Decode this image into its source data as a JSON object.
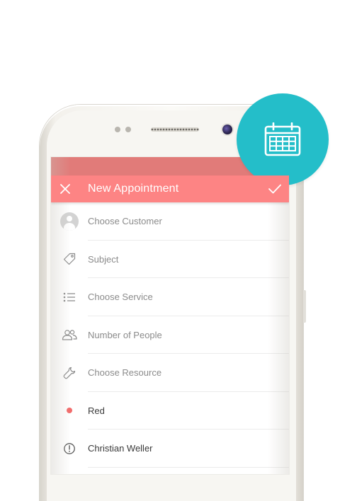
{
  "colors": {
    "accent": "#fd8484",
    "status_bar": "#e17b79",
    "badge": "#24bec9",
    "color_dot": "#f26b6b"
  },
  "app_bar": {
    "title": "New Appointment",
    "close_icon": "close-icon",
    "confirm_icon": "check-icon"
  },
  "form": {
    "rows": [
      {
        "icon": "avatar-icon",
        "label": "Choose Customer"
      },
      {
        "icon": "tag-icon",
        "label": "Subject"
      },
      {
        "icon": "list-icon",
        "label": "Choose Service"
      },
      {
        "icon": "people-icon",
        "label": "Number of People"
      },
      {
        "icon": "wrench-icon",
        "label": "Choose Resource"
      },
      {
        "icon": "color-dot-icon",
        "label": "Red"
      },
      {
        "icon": "alert-circle-icon",
        "label": "Christian Weller"
      }
    ]
  },
  "badge": {
    "icon": "calendar-icon"
  }
}
